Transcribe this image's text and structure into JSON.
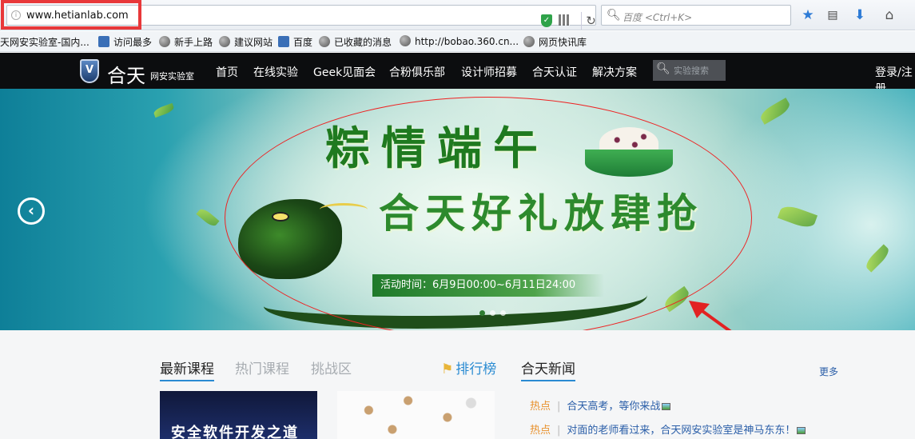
{
  "browser": {
    "url": "www.hetianlab.com",
    "search_placeholder": "百度 <Ctrl+K>",
    "icons": [
      "site-info-icon",
      "shield-icon",
      "qr-code-icon",
      "reload-icon",
      "search-icon",
      "bookmark-star-icon",
      "reading-list-icon",
      "download-icon",
      "home-icon"
    ]
  },
  "bookmarks": [
    {
      "label": "天网安实验室-国内..."
    },
    {
      "label": "访问最多"
    },
    {
      "label": "新手上路"
    },
    {
      "label": "建议网站"
    },
    {
      "label": "百度"
    },
    {
      "label": "已收藏的消息"
    },
    {
      "label": "http://bobao.360.cn..."
    },
    {
      "label": "网页快讯库"
    }
  ],
  "site": {
    "logo_main": "合天",
    "logo_sub": "网安实验室",
    "logo_mark": "V",
    "nav": [
      "首页",
      "在线实验",
      "Geek见面会",
      "合粉俱乐部",
      "设计师招募",
      "合天认证",
      "解决方案"
    ],
    "search_placeholder": "实验搜索",
    "login": "登录/注册"
  },
  "banner": {
    "title_line1": "粽情端午",
    "title_line2": "合天好礼放肆抢",
    "activity_time": "活动时间：6月9日00:00~6月11日24:00",
    "prev_symbol": "‹",
    "slide_count": 3,
    "active_slide": 0,
    "highlight_color": "#e22222"
  },
  "content": {
    "tabs": [
      {
        "label": "最新课程",
        "active": true
      },
      {
        "label": "热门课程",
        "active": false
      },
      {
        "label": "挑战区",
        "active": false
      }
    ],
    "ranking": "排行榜",
    "news_title": "合天新闻",
    "more": "更多",
    "course_cards": [
      {
        "title": "安全软件开发之道"
      },
      {
        "title": ""
      }
    ],
    "news": [
      {
        "tag": "热点",
        "text": "合天高考，等你来战"
      },
      {
        "tag": "热点",
        "text": "对面的老师看过来，合天网安实验室是神马东东！"
      }
    ],
    "accent_color": "#2a8bd2"
  }
}
